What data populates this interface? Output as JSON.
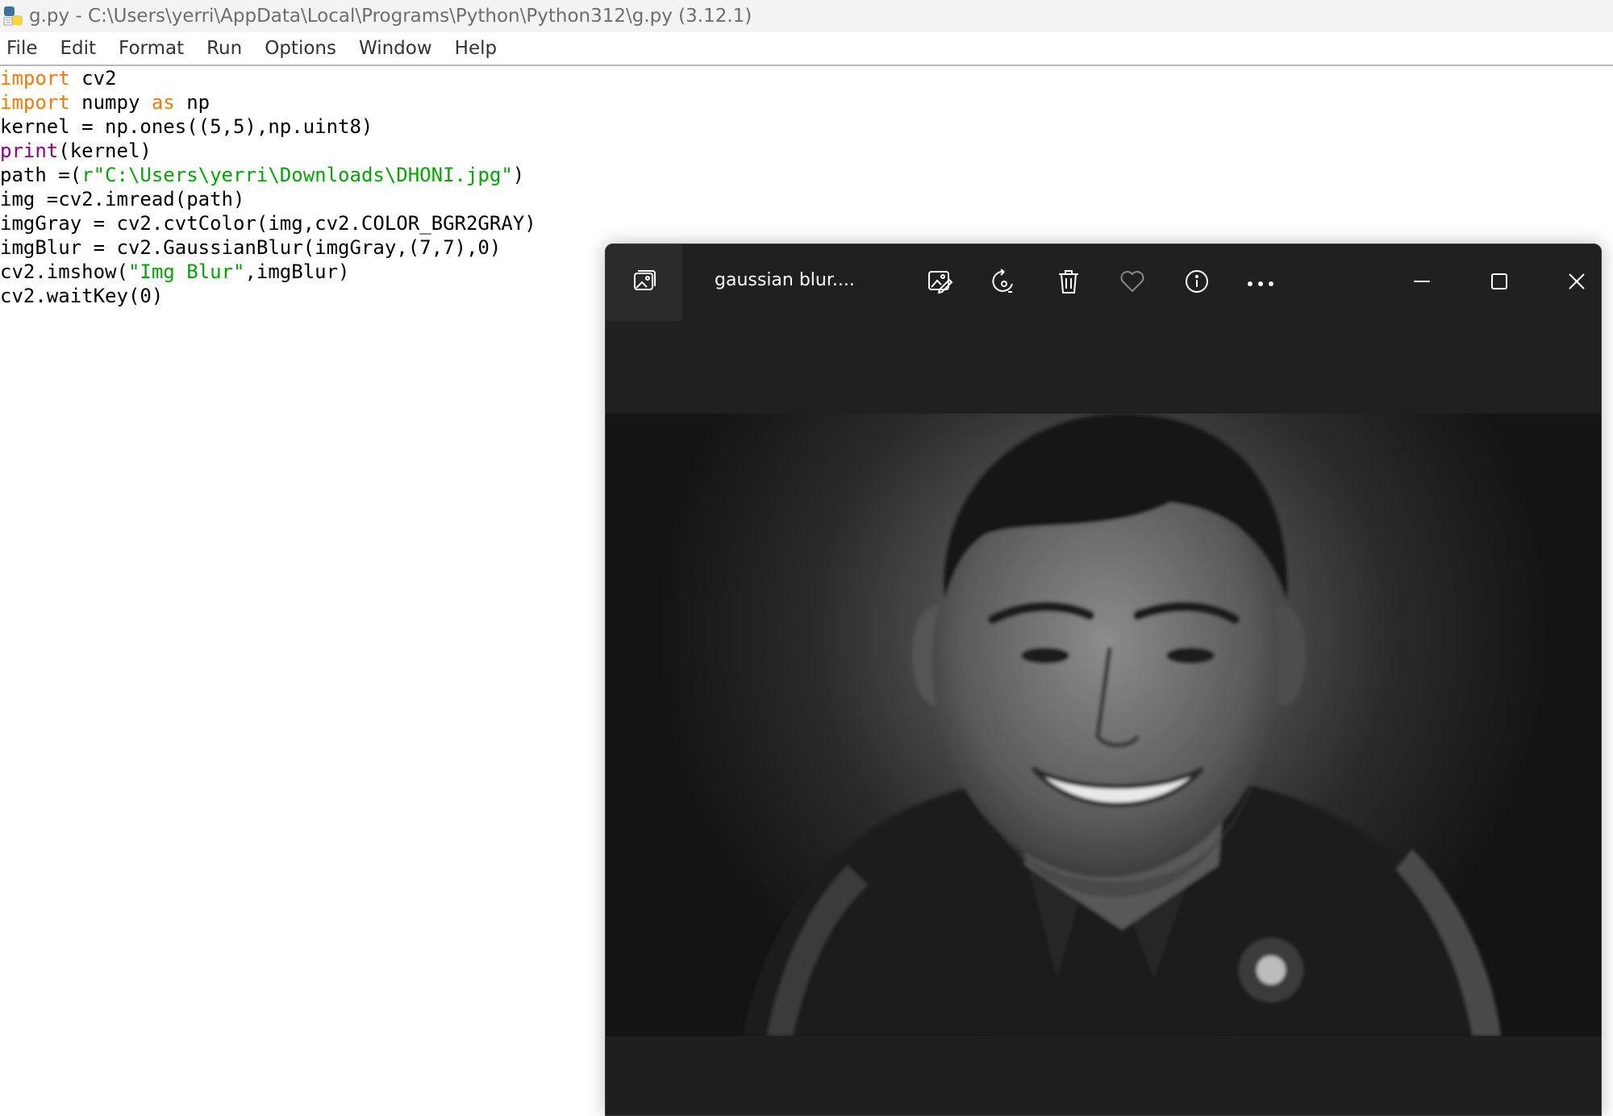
{
  "window": {
    "title": "g.py - C:\\Users\\yerri\\AppData\\Local\\Programs\\Python\\Python312\\g.py (3.12.1)"
  },
  "menu": [
    "File",
    "Edit",
    "Format",
    "Run",
    "Options",
    "Window",
    "Help"
  ],
  "code_lines": [
    [
      {
        "t": "import",
        "c": "kw"
      },
      {
        "t": " cv2",
        "c": ""
      }
    ],
    [
      {
        "t": "import",
        "c": "kw"
      },
      {
        "t": " numpy ",
        "c": ""
      },
      {
        "t": "as",
        "c": "kw"
      },
      {
        "t": " np",
        "c": ""
      }
    ],
    [
      {
        "t": "kernel = np.ones((5,5),np.uint8)",
        "c": ""
      }
    ],
    [
      {
        "t": "print",
        "c": "bi"
      },
      {
        "t": "(kernel)",
        "c": ""
      }
    ],
    [
      {
        "t": "path =(",
        "c": ""
      },
      {
        "t": "r\"C:\\Users\\yerri\\Downloads\\DHONI.jpg\"",
        "c": "st"
      },
      {
        "t": ")",
        "c": ""
      }
    ],
    [
      {
        "t": "img =cv2.imread(path)",
        "c": ""
      }
    ],
    [
      {
        "t": "imgGray = cv2.cvtColor(img,cv2.COLOR_BGR2GRAY)",
        "c": ""
      }
    ],
    [
      {
        "t": "imgBlur = cv2.GaussianBlur(imgGray,(7,7),0)",
        "c": ""
      }
    ],
    [
      {
        "t": "cv2.imshow(",
        "c": ""
      },
      {
        "t": "\"Img Blur\"",
        "c": "st"
      },
      {
        "t": ",imgBlur)",
        "c": ""
      }
    ],
    [
      {
        "t": "cv2.waitKey(0)",
        "c": ""
      }
    ]
  ],
  "viewer": {
    "title": "gaussian blur....",
    "icons": [
      "gallery-icon",
      "edit-image-icon",
      "rotate-icon",
      "delete-icon",
      "favorite-icon",
      "info-icon",
      "more-icon",
      "minimize-icon",
      "maximize-icon",
      "close-icon"
    ]
  },
  "colors": {
    "keyword": "#ff7700",
    "builtin": "#900090",
    "string": "#00aa00",
    "viewer_bg": "#202020"
  }
}
